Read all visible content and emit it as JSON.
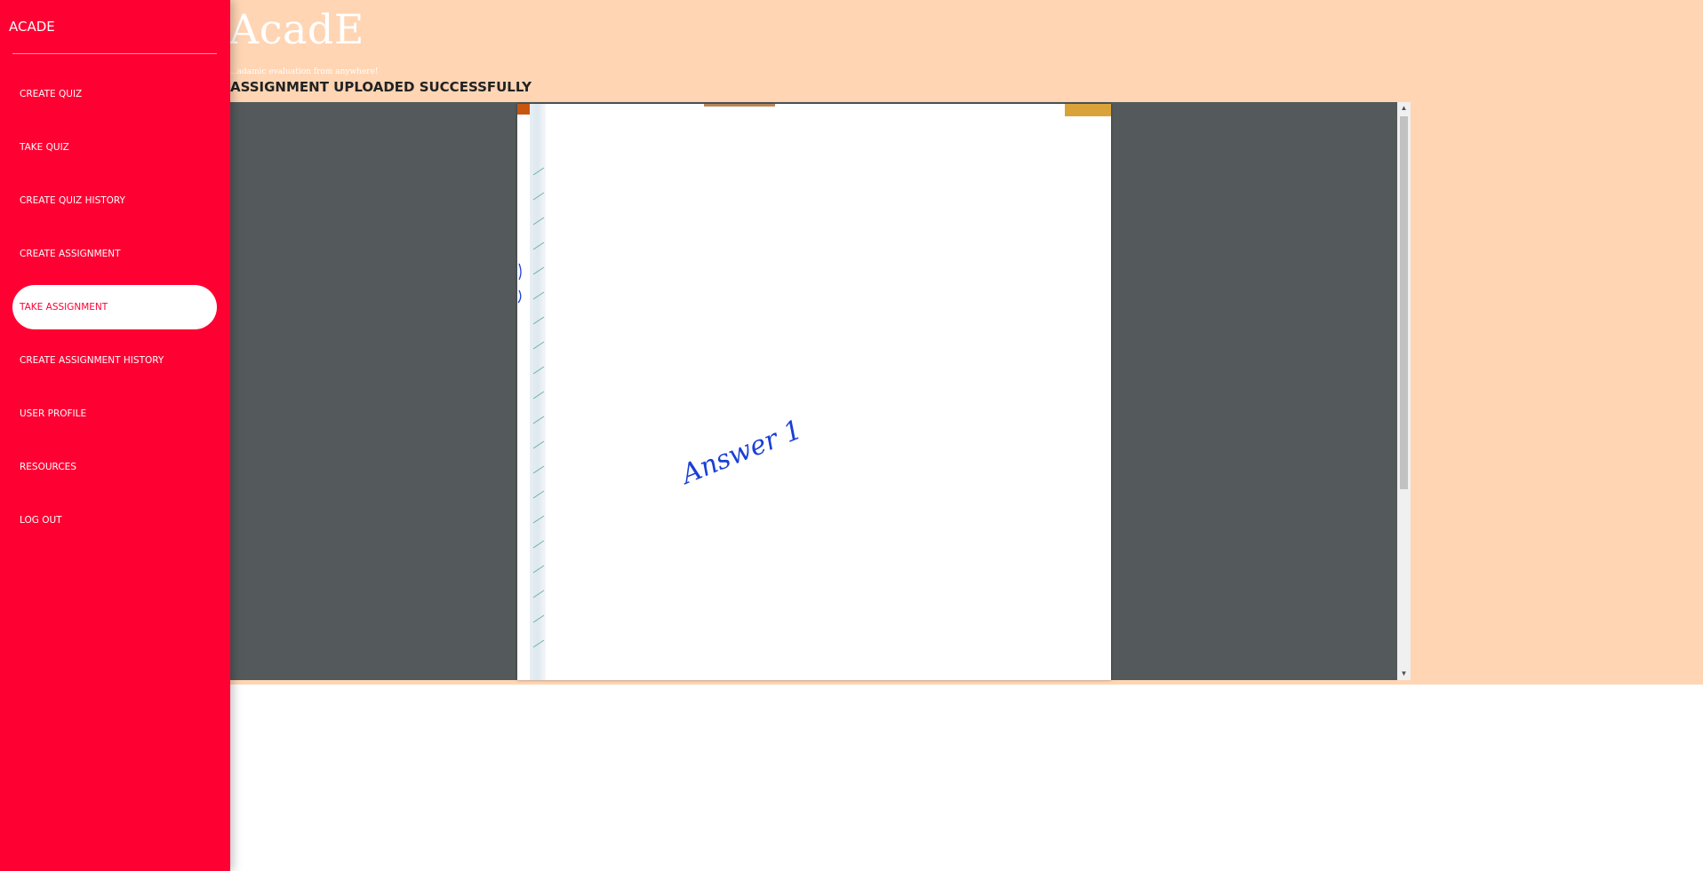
{
  "header": {
    "brand": "AcadE",
    "tagline": "...adamic evaluation from anywhere!",
    "status_message": "ASSIGNMENT UPLOADED SUCCESSFULLY"
  },
  "sidebar": {
    "title": "ACADE",
    "active_item": "TAKE ASSIGNMENT",
    "items": [
      {
        "label": "CREATE QUIZ"
      },
      {
        "label": "TAKE QUIZ"
      },
      {
        "label": "CREATE QUIZ HISTORY"
      },
      {
        "label": "CREATE ASSIGNMENT"
      },
      {
        "label": "TAKE ASSIGNMENT"
      },
      {
        "label": "CREATE ASSIGNMENT HISTORY"
      },
      {
        "label": "USER PROFILE"
      },
      {
        "label": "RESOURCES"
      },
      {
        "label": "LOG OUT"
      }
    ]
  },
  "viewer": {
    "handwritten_text": "Answer 1",
    "scroll_up_icon": "triangle-up-icon",
    "scroll_down_icon": "triangle-down-icon"
  },
  "colors": {
    "sidebar_bg": "#ff0033",
    "main_bg": "#ffd5b4",
    "viewer_bg": "#545a5c",
    "handwriting": "#1a3fd6"
  }
}
